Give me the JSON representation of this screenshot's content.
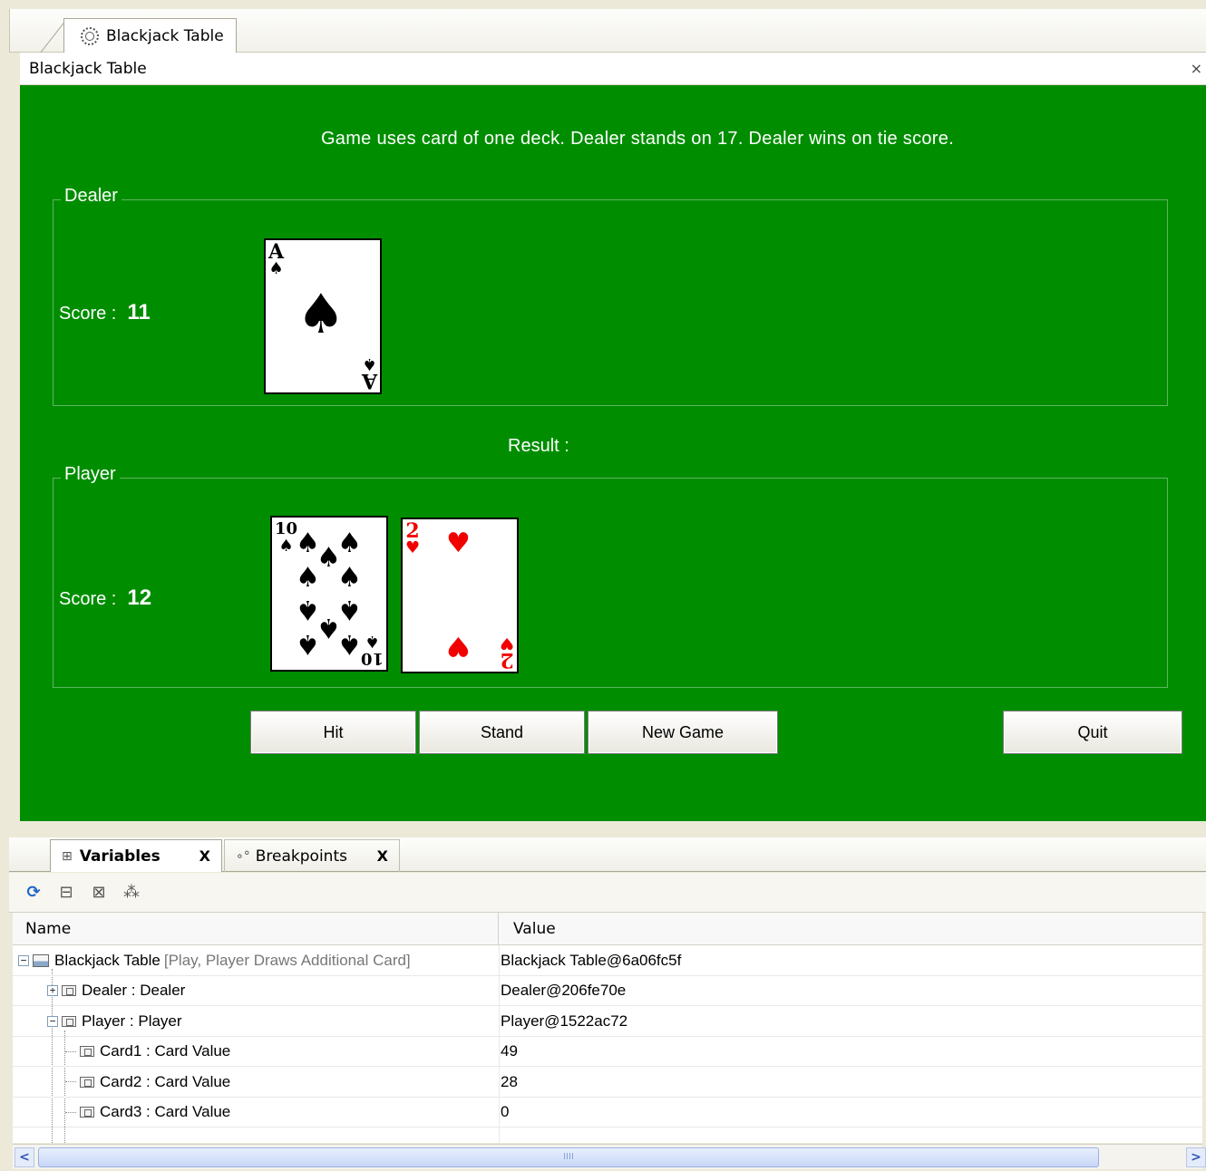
{
  "editor_tab": {
    "label": "Blackjack Table",
    "icon": "gear-icon"
  },
  "view": {
    "title": "Blackjack Table",
    "close": "×"
  },
  "table": {
    "rules": "Game uses card of one deck. Dealer stands on 17. Dealer wins on tie score.",
    "dealer": {
      "title": "Dealer",
      "score_label": "Score :",
      "score": "11",
      "cards": [
        {
          "rank": "A",
          "suit": "♠",
          "color": "black"
        }
      ]
    },
    "result_label": "Result :",
    "player": {
      "title": "Player",
      "score_label": "Score :",
      "score": "12",
      "cards": [
        {
          "rank": "10",
          "suit": "♠",
          "color": "black"
        },
        {
          "rank": "2",
          "suit": "♥",
          "color": "red"
        }
      ]
    },
    "buttons": {
      "hit": "Hit",
      "stand": "Stand",
      "new_game": "New Game",
      "quit": "Quit"
    },
    "background_color": "#008e00"
  },
  "bottom_tabs": [
    {
      "label": "Variables",
      "close": "X",
      "icon": "tree-icon"
    },
    {
      "label": "Breakpoints",
      "close": "X",
      "icon": "breakpoints-icon"
    }
  ],
  "toolbar_icons": [
    "refresh-icon",
    "expand-all-icon",
    "collapse-all-icon",
    "sort-icon"
  ],
  "tree": {
    "columns": {
      "name": "Name",
      "value": "Value"
    },
    "rows": [
      {
        "name": "Blackjack Table",
        "extra": "[Play, Player Draws Additional Card]",
        "value": "Blackjack Table@6a06fc5f"
      },
      {
        "name": "Dealer : Dealer",
        "value": "Dealer@206fe70e"
      },
      {
        "name": "Player : Player",
        "value": "Player@1522ac72"
      },
      {
        "name": "Card1 : Card Value",
        "value": "49"
      },
      {
        "name": "Card2 : Card Value",
        "value": "28"
      },
      {
        "name": "Card3 : Card Value",
        "value": "0"
      }
    ]
  },
  "scrollbar": {
    "left": "<",
    "right": ">",
    "grip": "IIII"
  }
}
